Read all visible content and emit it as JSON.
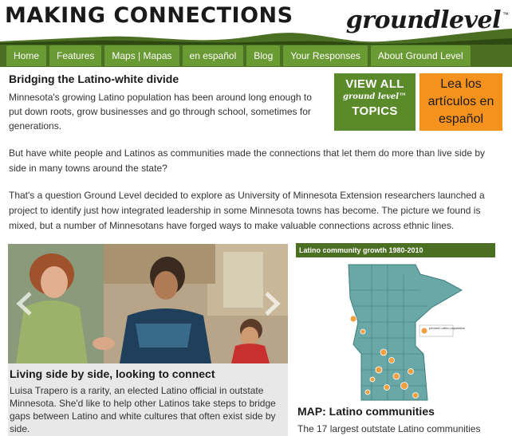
{
  "header": {
    "masthead": "MAKING CONNECTIONS",
    "brand": "groundlevel",
    "brand_tm": "™"
  },
  "nav": {
    "items": [
      {
        "label": "Home"
      },
      {
        "label": "Features"
      },
      {
        "label": "Maps | Mapas"
      },
      {
        "label": "en español"
      },
      {
        "label": "Blog"
      },
      {
        "label": "Your Responses"
      },
      {
        "label": "About Ground Level"
      }
    ]
  },
  "article": {
    "headline": "Bridging the Latino-white divide",
    "p1": "Minnesota's growing Latino population has been around long enough to put down roots, grow businesses and go through school, sometimes for generations.",
    "p2": "But have white people and Latinos as communities made the connections that let them do more than live side by side in many towns around the state?",
    "p3": "That's a question Ground Level decided to explore as University of Minnesota Extension researchers launched a project to identify just how integrated leadership in some Minnesota towns has become. The picture we found is mixed, but a number of Minnesotans have forged ways to make valuable connections across ethnic lines."
  },
  "promos": {
    "topics": {
      "line1": "VIEW ALL",
      "line2": "ground level™",
      "line3": "TOPICS"
    },
    "spanish": {
      "line1": "Lea los",
      "line2": "artículos en",
      "line3": "español"
    }
  },
  "feature": {
    "title": "Living side by side, looking to connect",
    "description": "Luisa Trapero is a rarity, an elected Latino official in outstate Minnesota. She'd like to help other Latinos take steps to bridge gaps between Latino and white cultures that often exist side by side."
  },
  "map": {
    "header": "Latino community growth 1980-2010",
    "legend_label": "percent Latino population",
    "title": "MAP: Latino communities",
    "description": "The 17 largest outstate Latino communities"
  },
  "colors": {
    "nav_bg": "#4a6e22",
    "nav_tab": "#6a9a33",
    "topics_btn": "#5b8a2a",
    "spanish_btn": "#f5921e",
    "map_fill": "#6aa8a8"
  },
  "icons": {
    "carousel_prev": "chevron-left-icon",
    "carousel_next": "chevron-right-icon"
  }
}
